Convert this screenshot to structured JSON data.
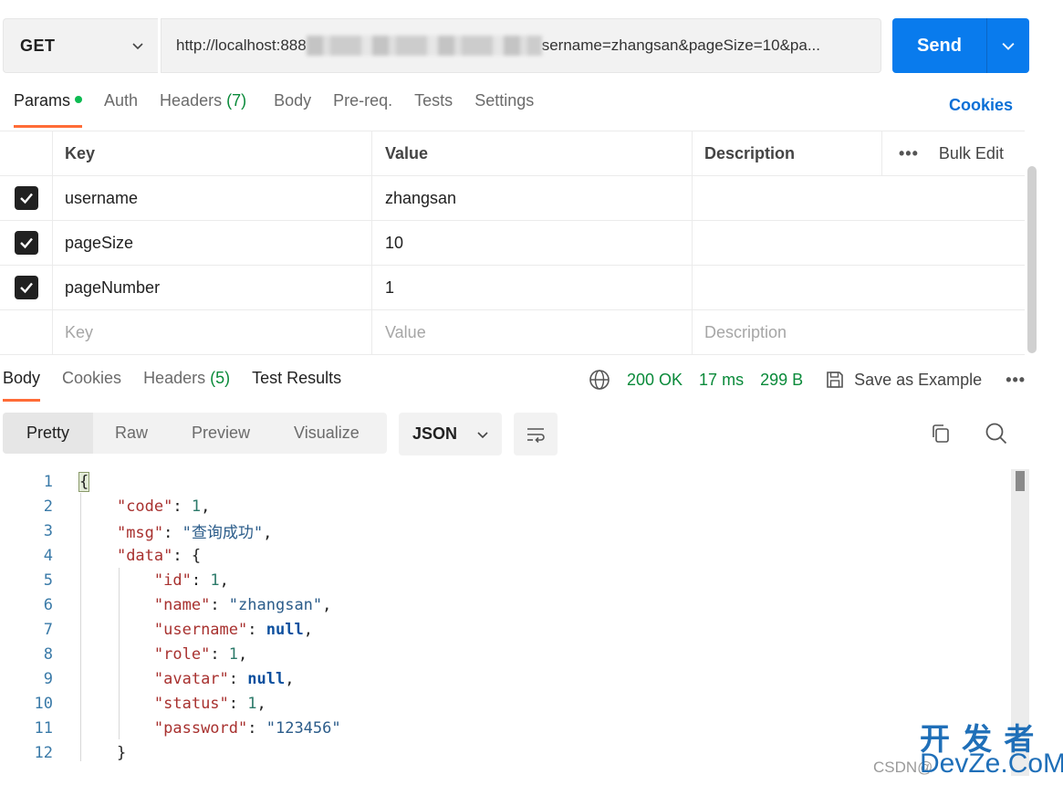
{
  "request": {
    "method": "GET",
    "url_prefix": "http://localhost:888",
    "url_suffix": "sername=zhangsan&pageSize=10&pa...",
    "send_label": "Send"
  },
  "request_tabs": [
    {
      "label": "Params",
      "active": true
    },
    {
      "label": "Auth"
    },
    {
      "label": "Headers",
      "count": "(7)"
    },
    {
      "label": "Body"
    },
    {
      "label": "Pre-req."
    },
    {
      "label": "Tests"
    },
    {
      "label": "Settings"
    }
  ],
  "cookies_link": "Cookies",
  "params": {
    "headers": {
      "key": "Key",
      "value": "Value",
      "description": "Description",
      "more": "•••",
      "bulk_edit": "Bulk Edit"
    },
    "rows": [
      {
        "key": "username",
        "value": "zhangsan",
        "checked": true
      },
      {
        "key": "pageSize",
        "value": "10",
        "checked": true
      },
      {
        "key": "pageNumber",
        "value": "1",
        "checked": true
      }
    ],
    "placeholders": {
      "key": "Key",
      "value": "Value",
      "description": "Description"
    }
  },
  "response_tabs": [
    {
      "label": "Body",
      "active": true
    },
    {
      "label": "Cookies"
    },
    {
      "label": "Headers",
      "count": "(5)"
    },
    {
      "label": "Test Results"
    }
  ],
  "response_meta": {
    "status": "200 OK",
    "time": "17 ms",
    "size": "299 B",
    "save_example": "Save as Example",
    "more": "•••"
  },
  "view_modes": [
    "Pretty",
    "Raw",
    "Preview",
    "Visualize"
  ],
  "format_select": "JSON",
  "code": {
    "line_numbers": [
      "1",
      "2",
      "3",
      "4",
      "5",
      "6",
      "7",
      "8",
      "9",
      "10",
      "11",
      "12"
    ],
    "open_brace": "{",
    "code_key": "\"code\"",
    "code_val": "1",
    "msg_key": "\"msg\"",
    "msg_val": "\"查询成功\"",
    "data_key": "\"data\"",
    "data_open": "{",
    "id_key": "\"id\"",
    "id_val": "1",
    "name_key": "\"name\"",
    "name_val": "\"zhangsan\"",
    "username_key": "\"username\"",
    "username_val": "null",
    "role_key": "\"role\"",
    "role_val": "1",
    "avatar_key": "\"avatar\"",
    "avatar_val": "null",
    "status_key": "\"status\"",
    "status_val": "1",
    "password_key": "\"password\"",
    "password_val": "\"123456\"",
    "data_close": "}"
  },
  "watermark": {
    "line1": "开 发 者",
    "line2": "DevZe.CoM",
    "csdn": "CSDN@"
  },
  "colors": {
    "accent": "#ff6c37",
    "send": "#097bed",
    "status_ok": "#0a8a3a",
    "link": "#0a6fd6"
  }
}
